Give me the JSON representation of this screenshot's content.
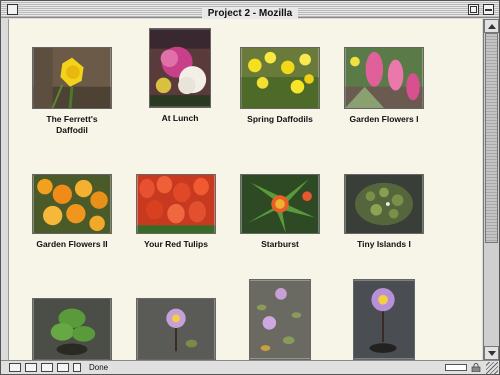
{
  "window": {
    "title": "Project 2 - Mozilla"
  },
  "gallery": {
    "items": [
      {
        "caption": "The Ferrett's Daffodil"
      },
      {
        "caption": "At Lunch"
      },
      {
        "caption": "Spring Daffodils"
      },
      {
        "caption": "Garden Flowers I"
      },
      {
        "caption": "Garden Flowers II"
      },
      {
        "caption": "Your Red Tulips"
      },
      {
        "caption": "Starburst"
      },
      {
        "caption": "Tiny Islands I"
      },
      {
        "caption": ""
      },
      {
        "caption": ""
      },
      {
        "caption": ""
      },
      {
        "caption": ""
      }
    ]
  },
  "statusbar": {
    "text": "Done"
  },
  "colors": {
    "content_bg": "#f7f4e8",
    "chrome": "#dcdcdc"
  }
}
